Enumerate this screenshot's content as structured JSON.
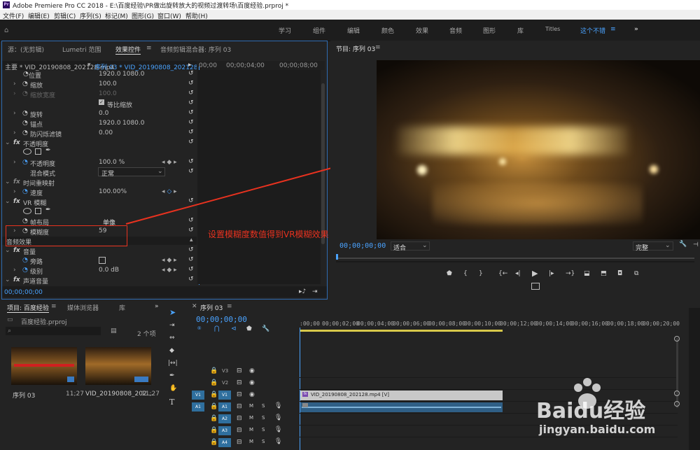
{
  "app": {
    "title": "Adobe Premiere Pro CC 2018 - E:\\百度经验\\PR做出旋转放大的视频过渡转场\\百度经验.prproj *",
    "logo_text": "Pr"
  },
  "menu": [
    "文件(F)",
    "编辑(E)",
    "剪辑(C)",
    "序列(S)",
    "标记(M)",
    "图形(G)",
    "窗口(W)",
    "帮助(H)"
  ],
  "workspaces": [
    "学习",
    "组件",
    "编辑",
    "颜色",
    "效果",
    "音频",
    "图形",
    "库",
    "Titles",
    "这个不错"
  ],
  "workspace_active": "这个不错",
  "effect_panel": {
    "tabs": [
      "源：(无剪辑)",
      "Lumetri 范围",
      "效果控件",
      "音频剪辑混合器: 序列 03"
    ],
    "active_tab": "效果控件",
    "master_clip": "主要 * VID_20190808_202128.mp4",
    "sequence_clip": "序列 03 * VID_20190808_202128...",
    "ruler_labels": [
      "00;00",
      "00;00;04;00",
      "00;00;08;00"
    ],
    "rows": [
      {
        "label": "位置",
        "v1": "1920.0",
        "v2": "1080.0"
      },
      {
        "label": "缩放",
        "v1": "100.0",
        "v2": ""
      },
      {
        "label": "缩放宽度",
        "v1": "100.0",
        "v2": ""
      },
      {
        "label": "等比缩放",
        "v1": "",
        "v2": ""
      },
      {
        "label": "旋转",
        "v1": "0.0",
        "v2": ""
      },
      {
        "label": "锚点",
        "v1": "1920.0",
        "v2": "1080.0"
      },
      {
        "label": "防闪烁滤镜",
        "v1": "0.00",
        "v2": ""
      },
      {
        "label": "不透明度",
        "v1": "",
        "v2": ""
      },
      {
        "label": "",
        "v1": "",
        "v2": ""
      },
      {
        "label": "不透明度",
        "v1": "100.0 %",
        "v2": ""
      },
      {
        "label": "混合模式",
        "v1": "正常",
        "v2": ""
      },
      {
        "label": "时间重映射",
        "v1": "",
        "v2": ""
      },
      {
        "label": "速度",
        "v1": "100.00%",
        "v2": ""
      },
      {
        "label": "VR 模糊",
        "v1": "",
        "v2": ""
      },
      {
        "label": "",
        "v1": "",
        "v2": ""
      },
      {
        "label": "帧布局",
        "v1": "单像",
        "v2": ""
      },
      {
        "label": "模糊度",
        "v1": "59",
        "v2": ""
      },
      {
        "label": "音频效果",
        "v1": "",
        "v2": ""
      },
      {
        "label": "音量",
        "v1": "",
        "v2": ""
      },
      {
        "label": "旁路",
        "v1": "",
        "v2": ""
      },
      {
        "label": "级别",
        "v1": "0.0 dB",
        "v2": ""
      },
      {
        "label": "声道音量",
        "v1": "",
        "v2": ""
      }
    ],
    "timecode": "00;00;00;00"
  },
  "annotation": {
    "text": "设置模糊度数值得到VR模糊效果",
    "color": "#e8321f"
  },
  "program_monitor": {
    "title": "节目: 序列 03",
    "timecode": "00;00;00;00",
    "fit": "适合",
    "quality": "完整"
  },
  "project_panel": {
    "tabs": [
      "项目: 百度经验",
      "媒体浏览器",
      "库"
    ],
    "active_tab": "项目: 百度经验",
    "project_file": "百度经验.prproj",
    "item_count": "2 个项",
    "items": [
      {
        "name": "序列 03",
        "duration": "11;27"
      },
      {
        "name": "VID_20190808_202...",
        "duration": "11;27"
      }
    ]
  },
  "timeline": {
    "tab": "序列 03",
    "timecode": "00;00;00;00",
    "ruler": [
      ":00;00",
      "00;00;02;00",
      "00;00;04;00",
      "00;00;06;00",
      "00;00;08;00",
      "00;00;10;00",
      "00;00;12;00",
      "00;00;14;00",
      "00;00;16;00",
      "00;00;18;00",
      "00;00;20;00"
    ],
    "video_tracks": [
      "V3",
      "V2",
      "V1"
    ],
    "audio_tracks": [
      "A1",
      "A2",
      "A3",
      "A4"
    ],
    "video_clip": "VID_20190808_202128.mp4 [V]"
  },
  "watermark": {
    "brand": "Baidu经验",
    "url": "jingyan.baidu.com"
  },
  "colors": {
    "accent": "#4aa3ff",
    "annotation": "#e8321f",
    "clip_video": "#c8c8c8",
    "clip_audio": "#2f5f86"
  }
}
